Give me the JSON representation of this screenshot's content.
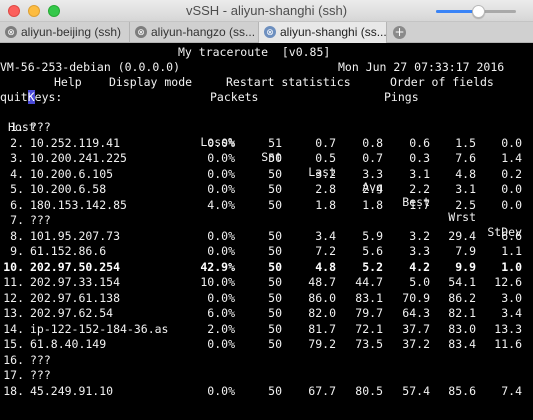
{
  "window": {
    "title": "vSSH - aliyun-shanghi (ssh)"
  },
  "volume": {
    "level": 0.52
  },
  "tabs": [
    {
      "label": "aliyun-beijing (ssh)",
      "close": "⊗",
      "active": false
    },
    {
      "label": "aliyun-hangzo (ss...",
      "close": "⊗",
      "active": false
    },
    {
      "label": "aliyun-shanghi (ss...",
      "close": "⊗",
      "active": true
    }
  ],
  "new_tab_label": "+",
  "terminal": {
    "program_title": "My traceroute  [v0.85]",
    "hostname": "VM-56-253-debian (0.0.0.0)",
    "datetime": "Mon Jun 27 07:33:17 2016",
    "keys_hotkey": "K",
    "keys_rest": "eys:",
    "menu": {
      "help": "Help",
      "display_mode": "Display mode",
      "restart": "Restart statistics",
      "order": "Order of fields",
      "quit": "quit"
    },
    "group_headers": {
      "packets": "Packets",
      "pings": "Pings"
    },
    "columns": {
      "host": "Host",
      "loss": "Loss%",
      "snt": "Snt",
      "last": "Last",
      "avg": "Avg",
      "best": "Best",
      "wrst": "Wrst",
      "stdev": "StDev"
    },
    "hops": [
      {
        "n": "1.",
        "host": "???",
        "loss": "",
        "snt": "",
        "last": "",
        "avg": "",
        "best": "",
        "wrst": "",
        "stdev": "",
        "bold": false
      },
      {
        "n": "2.",
        "host": "10.252.119.41",
        "loss": "0.0%",
        "snt": "51",
        "last": "0.7",
        "avg": "0.8",
        "best": "0.6",
        "wrst": "1.5",
        "stdev": "0.0",
        "bold": false
      },
      {
        "n": "3.",
        "host": "10.200.241.225",
        "loss": "0.0%",
        "snt": "50",
        "last": "0.5",
        "avg": "0.7",
        "best": "0.3",
        "wrst": "7.6",
        "stdev": "1.4",
        "bold": false
      },
      {
        "n": "4.",
        "host": "10.200.6.105",
        "loss": "0.0%",
        "snt": "50",
        "last": "3.2",
        "avg": "3.3",
        "best": "3.1",
        "wrst": "4.8",
        "stdev": "0.2",
        "bold": false
      },
      {
        "n": "5.",
        "host": "10.200.6.58",
        "loss": "0.0%",
        "snt": "50",
        "last": "2.8",
        "avg": "2.4",
        "best": "2.2",
        "wrst": "3.1",
        "stdev": "0.0",
        "bold": false
      },
      {
        "n": "6.",
        "host": "180.153.142.85",
        "loss": "4.0%",
        "snt": "50",
        "last": "1.8",
        "avg": "1.8",
        "best": "1.7",
        "wrst": "2.5",
        "stdev": "0.0",
        "bold": false
      },
      {
        "n": "7.",
        "host": "???",
        "loss": "",
        "snt": "",
        "last": "",
        "avg": "",
        "best": "",
        "wrst": "",
        "stdev": "",
        "bold": false
      },
      {
        "n": "8.",
        "host": "101.95.207.73",
        "loss": "0.0%",
        "snt": "50",
        "last": "3.4",
        "avg": "5.9",
        "best": "3.2",
        "wrst": "29.4",
        "stdev": "6.6",
        "bold": false
      },
      {
        "n": "9.",
        "host": "61.152.86.6",
        "loss": "0.0%",
        "snt": "50",
        "last": "7.2",
        "avg": "5.6",
        "best": "3.3",
        "wrst": "7.9",
        "stdev": "1.1",
        "bold": false
      },
      {
        "n": "10.",
        "host": "202.97.50.254",
        "loss": "42.9%",
        "snt": "50",
        "last": "4.8",
        "avg": "5.2",
        "best": "4.2",
        "wrst": "9.9",
        "stdev": "1.0",
        "bold": true
      },
      {
        "n": "11.",
        "host": "202.97.33.154",
        "loss": "10.0%",
        "snt": "50",
        "last": "48.7",
        "avg": "44.7",
        "best": "5.0",
        "wrst": "54.1",
        "stdev": "12.6",
        "bold": false
      },
      {
        "n": "12.",
        "host": "202.97.61.138",
        "loss": "0.0%",
        "snt": "50",
        "last": "86.0",
        "avg": "83.1",
        "best": "70.9",
        "wrst": "86.2",
        "stdev": "3.0",
        "bold": false
      },
      {
        "n": "13.",
        "host": "202.97.62.54",
        "loss": "6.0%",
        "snt": "50",
        "last": "82.0",
        "avg": "79.7",
        "best": "64.3",
        "wrst": "82.1",
        "stdev": "3.4",
        "bold": false
      },
      {
        "n": "14.",
        "host": "ip-122-152-184-36.as",
        "loss": "2.0%",
        "snt": "50",
        "last": "81.7",
        "avg": "72.1",
        "best": "37.7",
        "wrst": "83.0",
        "stdev": "13.3",
        "bold": false
      },
      {
        "n": "15.",
        "host": "61.8.40.149",
        "loss": "0.0%",
        "snt": "50",
        "last": "79.2",
        "avg": "73.5",
        "best": "37.2",
        "wrst": "83.4",
        "stdev": "11.6",
        "bold": false
      },
      {
        "n": "16.",
        "host": "???",
        "loss": "",
        "snt": "",
        "last": "",
        "avg": "",
        "best": "",
        "wrst": "",
        "stdev": "",
        "bold": false
      },
      {
        "n": "17.",
        "host": "???",
        "loss": "",
        "snt": "",
        "last": "",
        "avg": "",
        "best": "",
        "wrst": "",
        "stdev": "",
        "bold": false
      },
      {
        "n": "18.",
        "host": "45.249.91.10",
        "loss": "0.0%",
        "snt": "50",
        "last": "67.7",
        "avg": "80.5",
        "best": "57.4",
        "wrst": "85.6",
        "stdev": "7.4",
        "bold": false
      }
    ]
  }
}
